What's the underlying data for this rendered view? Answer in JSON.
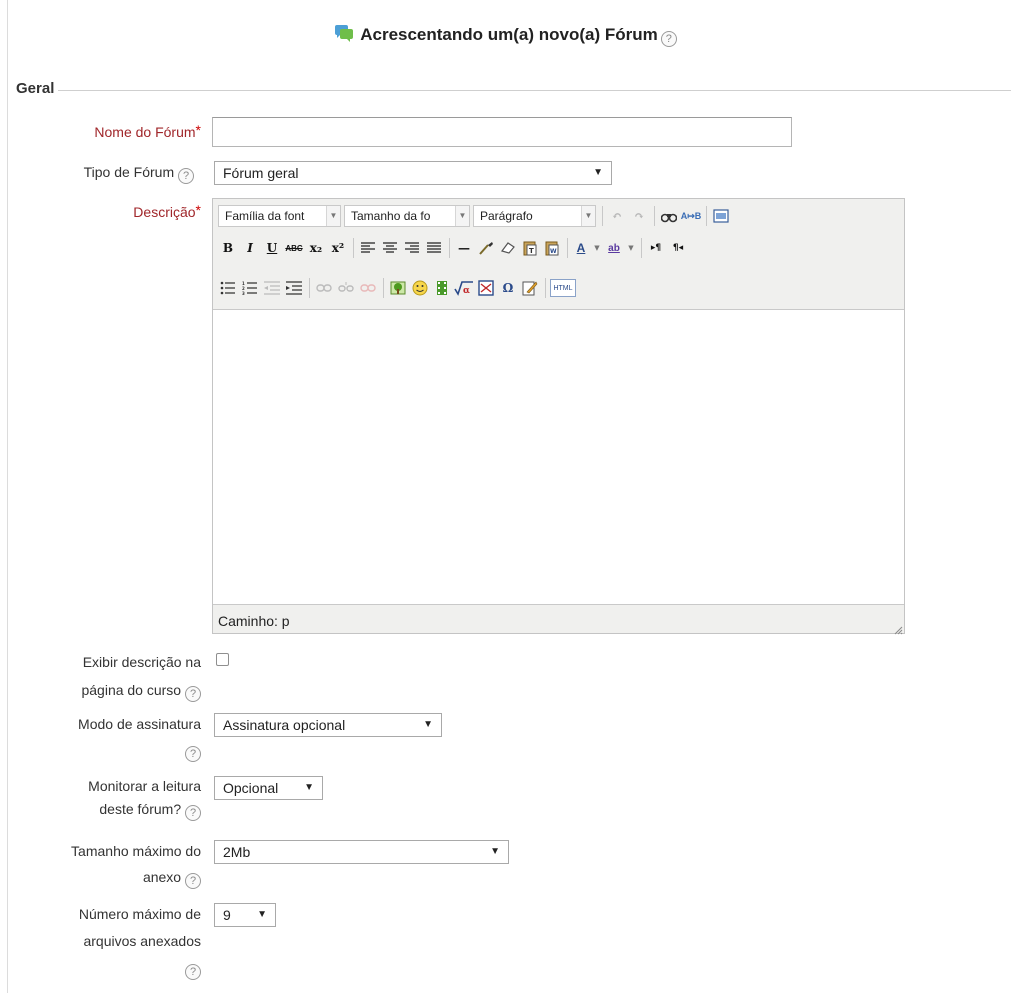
{
  "page": {
    "title": "Acrescentando um(a) novo(a) Fórum",
    "help_glyph": "?"
  },
  "section": {
    "legend": "Geral"
  },
  "fields": {
    "name": {
      "label": "Nome do Fórum",
      "required_marker": "*",
      "value": ""
    },
    "type": {
      "label": "Tipo de Fórum",
      "value": "Fórum geral"
    },
    "description": {
      "label": "Descrição",
      "required_marker": "*",
      "toolbar": {
        "font_family": "Família da font",
        "font_size": "Tamanho da fo",
        "format": "Parágrafo",
        "bold": "B",
        "italic": "I",
        "underline": "U",
        "strike": "ABC",
        "subscript": "x₂",
        "superscript": "x²",
        "horizontal_rule": "—",
        "font_color": "A",
        "highlight": "ab",
        "omega": "Ω",
        "html": "HTML",
        "ltr": "▸¶",
        "rtl": "¶◂"
      },
      "path_label": "Caminho: p",
      "content": ""
    },
    "show_description": {
      "label_line1": "Exibir descrição na",
      "label_line2": "página do curso",
      "checked": false
    },
    "subscription": {
      "label": "Modo de assinatura",
      "value": "Assinatura opcional"
    },
    "tracking": {
      "label_line1": "Monitorar a leitura",
      "label_line2": "deste fórum?",
      "value": "Opcional"
    },
    "max_attachment": {
      "label_line1": "Tamanho máximo do",
      "label_line2": "anexo",
      "value": "2Mb"
    },
    "max_files": {
      "label_line1": "Número máximo de",
      "label_line2": "arquivos anexados",
      "value": "9"
    }
  },
  "colors": {
    "required_label": "#a0262a",
    "required_star": "#cc0000"
  }
}
